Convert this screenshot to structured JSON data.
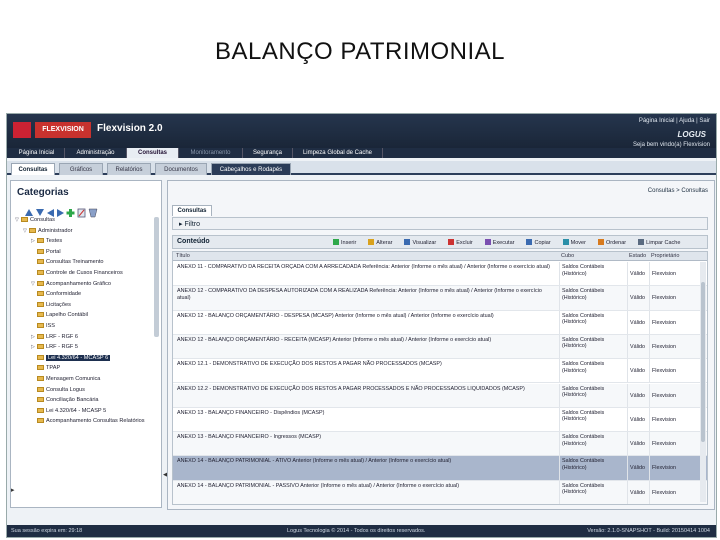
{
  "slide": {
    "title": "BALANÇO PATRIMONIAL"
  },
  "app": {
    "brand": "FLEXVISION",
    "title": "Flexvision 2.0",
    "top_links": "Página Inicial | Ajuda | Sair",
    "vendor": "LOGUS",
    "user_line": "Seja bem vindo(a) Flexvision"
  },
  "menu": {
    "tabs": [
      "Página Inicial",
      "Administração",
      "Consultas",
      "Monitoramento",
      "Segurança",
      "Limpeza Global de Cache"
    ],
    "active": "Consultas"
  },
  "subtabs": {
    "items": [
      "Consultas",
      "Gráficos",
      "Relatórios",
      "Documentos",
      "Cabeçalhos e Rodapés"
    ],
    "active": "Cabeçalhos e Rodapés"
  },
  "left_panel": {
    "title": "Categorias",
    "tree": [
      {
        "label": "Consultas",
        "level": 0,
        "exp": "▽"
      },
      {
        "label": "Administrador",
        "level": 1,
        "exp": "▽"
      },
      {
        "label": "Testes",
        "level": 2,
        "exp": "▷"
      },
      {
        "label": "Portal",
        "level": 2,
        "exp": ""
      },
      {
        "label": "Consultas Treinamento",
        "level": 2,
        "exp": ""
      },
      {
        "label": "Controle de Cusos Financeiros",
        "level": 2,
        "exp": ""
      },
      {
        "label": "Acompanhamento Gráfico",
        "level": 2,
        "exp": "▽"
      },
      {
        "label": "Conformidade",
        "level": 2,
        "exp": ""
      },
      {
        "label": "Licitações",
        "level": 2,
        "exp": ""
      },
      {
        "label": "Lapelho Contábil",
        "level": 2,
        "exp": ""
      },
      {
        "label": "ISS",
        "level": 2,
        "exp": ""
      },
      {
        "label": "LRF - RGF 6",
        "level": 2,
        "exp": "▷"
      },
      {
        "label": "LRF - RGF 5",
        "level": 2,
        "exp": "▷"
      },
      {
        "label": "Lei 4.320/64 - MCASP 6",
        "level": 2,
        "exp": "",
        "selected": true
      },
      {
        "label": "TPAP",
        "level": 2,
        "exp": ""
      },
      {
        "label": "Mensagem Comunica",
        "level": 2,
        "exp": ""
      },
      {
        "label": "Consulta Logus",
        "level": 2,
        "exp": ""
      },
      {
        "label": "Conciliação Bancária",
        "level": 2,
        "exp": ""
      },
      {
        "label": "Lei 4.320/64 - MCASP 5",
        "level": 2,
        "exp": ""
      },
      {
        "label": "Acompanhamento Consultas Relatórios",
        "level": 2,
        "exp": ""
      }
    ]
  },
  "right_panel": {
    "breadcrumb": "Consultas > Consultas",
    "tab": "Consultas",
    "filter_label": "Filtro",
    "content_label": "Conteúdo",
    "actions": [
      "Inserir",
      "Alterar",
      "Visualizar",
      "Excluir",
      "Executar",
      "Copiar",
      "Mover",
      "Ordenar",
      "Limpar Cache"
    ],
    "columns": [
      "Título",
      "Cubo",
      "Estado",
      "Proprietário"
    ],
    "rows": [
      {
        "title": "ANEXO 11 - COMPARATIVO DA RECEITA ORÇADA COM A ARRECADADA Referência: Anterior (Informe o mês atual) / Anterior (Informe o exercício atual)",
        "cubo": "Saldos Contábeis (Histórico)",
        "estado": "Válido",
        "prop": "Flexvision"
      },
      {
        "title": "ANEXO 12 - COMPARATIVO DA DESPESA AUTORIZADA COM A REALIZADA Referência: Anterior (Informe o mês atual) / Anterior (Informe o exercício atual)",
        "cubo": "Saldos Contábeis (Histórico)",
        "estado": "Válido",
        "prop": "Flexvision"
      },
      {
        "title": "ANEXO 12 - BALANÇO ORÇAMENTÁRIO - DESPESA (MCASP) Anterior (Informe o mês atual) / Anterior (Informe o exercício atual)",
        "cubo": "Saldos Contábeis (Histórico)",
        "estado": "Válido",
        "prop": "Flexvision"
      },
      {
        "title": "ANEXO 12 - BALANÇO ORÇAMENTÁRIO - RECEITA (MCASP) Anterior (Informe o mês atual) / Anterior (Informe o exercício atual)",
        "cubo": "Saldos Contábeis (Histórico)",
        "estado": "Válido",
        "prop": "Flexvision"
      },
      {
        "title": "ANEXO 12.1 - DEMONSTRATIVO DE EXECUÇÃO DOS RESTOS A PAGAR NÃO PROCESSADOS (MCASP)",
        "cubo": "Saldos Contábeis (Histórico)",
        "estado": "Válido",
        "prop": "Flexvision"
      },
      {
        "title": "ANEXO 12.2 - DEMONSTRATIVO DE EXECUÇÃO DOS RESTOS A PAGAR PROCESSADOS E NÃO PROCESSADOS LIQUIDADOS (MCASP)",
        "cubo": "Saldos Contábeis (Histórico)",
        "estado": "Válido",
        "prop": "Flexvision"
      },
      {
        "title": "ANEXO 13 - BALANÇO FINANCEIRO - Dispêndios (MCASP)",
        "cubo": "Saldos Contábeis (Histórico)",
        "estado": "Válido",
        "prop": "Flexvision"
      },
      {
        "title": "ANEXO 13 - BALANÇO FINANCEIRO - Ingressos (MCASP)",
        "cubo": "Saldos Contábeis (Histórico)",
        "estado": "Válido",
        "prop": "Flexvision"
      },
      {
        "title": "ANEXO 14 - BALANÇO PATRIMONIAL - ATIVO Anterior (Informe o mês atual) / Anterior (Informe o exercício atual)",
        "cubo": "Saldos Contábeis (Histórico)",
        "estado": "Válido",
        "prop": "Flexvision",
        "selected": true
      },
      {
        "title": "ANEXO 14 - BALANÇO PATRIMONIAL - PASSIVO Anterior (Informe o mês atual) / Anterior (Informe o exercício atual)",
        "cubo": "Saldos Contábeis (Histórico)",
        "estado": "Válido",
        "prop": "Flexvision"
      }
    ]
  },
  "footer": {
    "left": "Sua sessão expira em: 29:18",
    "mid": "Logus Tecnologia © 2014 - Todos os direitos reservados.",
    "right": "Versão: 2.1.0-SNAPSHOT - Build: 20150414 1004"
  },
  "colors": {
    "topbar": "#1f2d43",
    "brand": "#c8322e",
    "selection": "#a9b6cc"
  }
}
